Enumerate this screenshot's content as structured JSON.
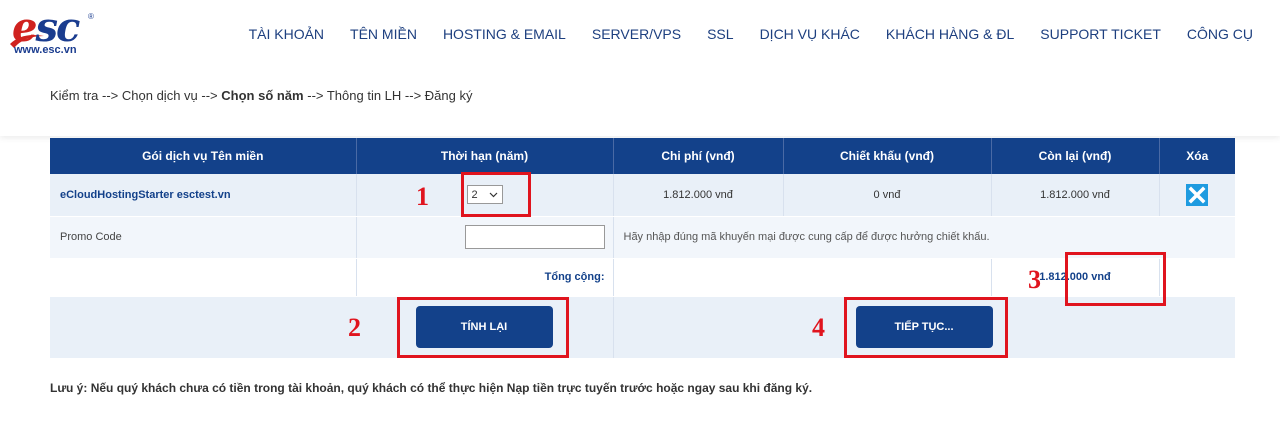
{
  "logo": {
    "text": "esc",
    "url": "www.esc.vn",
    "reg": "®"
  },
  "nav": [
    "TÀI KHOẢN",
    "TÊN MIỀN",
    "HOSTING & EMAIL",
    "SERVER/VPS",
    "SSL",
    "DỊCH VỤ KHÁC",
    "KHÁCH HÀNG & ĐL",
    "SUPPORT TICKET",
    "CÔNG CỤ"
  ],
  "breadcrumb": {
    "step1": "Kiểm tra -->",
    "step2": "Chọn dịch vụ -->",
    "step3": "Chọn số năm",
    "step4": "--> Thông tin LH --> Đăng ký"
  },
  "table": {
    "headers": [
      "Gói dịch vụ Tên miền",
      "Thời hạn (năm)",
      "Chi phí (vnđ)",
      "Chiết khấu (vnđ)",
      "Còn lại (vnđ)",
      "Xóa"
    ],
    "row": {
      "package": "eCloudHostingStarter esctest.vn",
      "years": "2",
      "cost": "1.812.000 vnđ",
      "discount": "0 vnđ",
      "remaining": "1.812.000 vnđ"
    },
    "promo": {
      "label": "Promo Code",
      "value": "",
      "hint": "Hãy nhập đúng mã khuyến mại được cung cấp để được hưởng chiết khấu."
    },
    "total": {
      "label": "Tổng cộng:",
      "value": "1.812.000 vnđ"
    },
    "buttons": {
      "recalc": "TÍNH LẠI",
      "continue": "TIẾP TỤC..."
    }
  },
  "annotations": {
    "a1": "1",
    "a2": "2",
    "a3": "3",
    "a4": "4"
  },
  "note": "Lưu ý: Nếu quý khách chưa có tiền trong tài khoản, quý khách có thể thực hiện Nạp tiền trực tuyến trước hoặc ngay sau khi đăng ký.",
  "colors": {
    "primary": "#13418a",
    "annotation": "#e0141e",
    "delete": "#1e9be0"
  }
}
